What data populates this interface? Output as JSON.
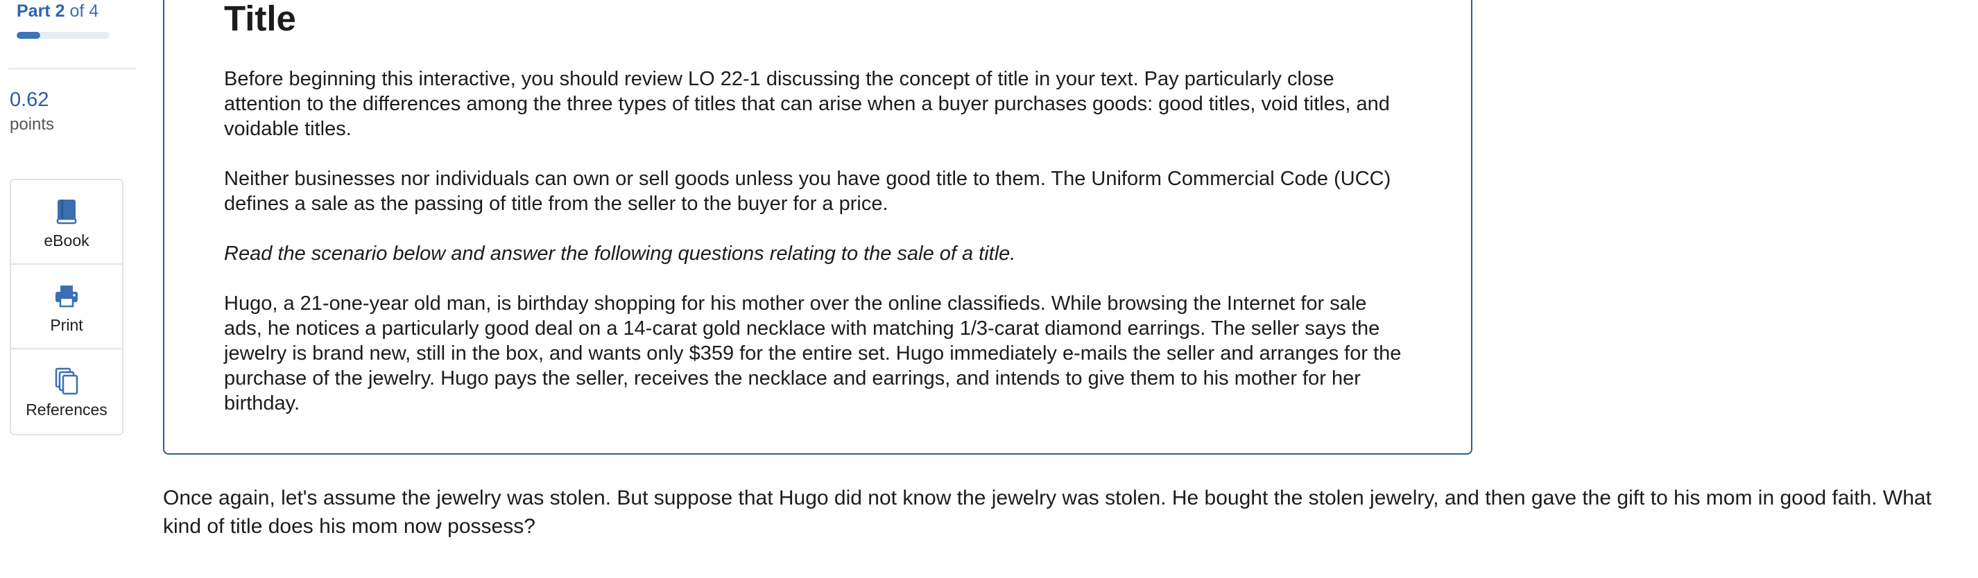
{
  "progress": {
    "part_word": "Part",
    "part_current": "2",
    "part_total_text": "of 4",
    "fraction": 0.25
  },
  "score": {
    "value": "0.62",
    "label": "points"
  },
  "tools": [
    {
      "label": "eBook",
      "icon": "book-icon"
    },
    {
      "label": "Print",
      "icon": "printer-icon"
    },
    {
      "label": "References",
      "icon": "copy-documents-icon"
    }
  ],
  "intro": {
    "title": "Title",
    "paragraphs": [
      "Before beginning this interactive, you should review LO 22-1 discussing the concept of title in your text. Pay particularly close attention to the differences among the three types of titles that can arise when a buyer purchases goods: good titles, void titles, and voidable titles.",
      "Neither businesses nor individuals can own or sell goods unless you have good title to them. The Uniform Commercial Code (UCC) defines a sale as the passing of title from the seller to the buyer for a price.",
      "Read the scenario below and answer the following questions relating to the sale of a title.",
      "Hugo, a 21-one-year old man, is birthday shopping for his mother over the online classifieds. While browsing the Internet for sale ads, he notices a particularly good deal on a 14-carat gold necklace with matching 1/3-carat diamond earrings. The seller says the jewelry is brand new, still in the box, and wants only $359 for the entire set. Hugo immediately e-mails the seller and arranges for the purchase of the jewelry. Hugo pays the seller, receives the necklace and earrings, and intends to give them to his mother for her birthday."
    ]
  },
  "question": {
    "text": "Once again, let's assume the jewelry was stolen. But suppose that Hugo did not know the jewelry was stolen. He bought the stolen jewelry, and then gave the gift to his mom in good faith. What kind of title does his mom now possess?"
  },
  "colors": {
    "accent": "#2f64ab",
    "panel_border": "#2d5b92",
    "progress_fill": "#3f73b8",
    "icon_blue": "#3a6fb3"
  }
}
